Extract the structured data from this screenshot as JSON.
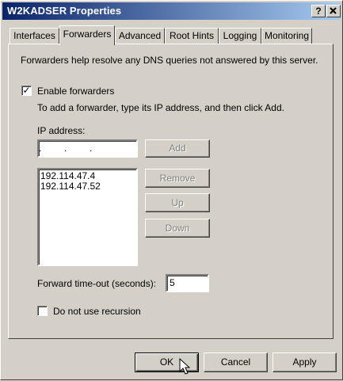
{
  "window": {
    "title": "W2KADSER Properties"
  },
  "titlebar_buttons": {
    "help": "?",
    "close": "X"
  },
  "tabs": [
    {
      "label": "Interfaces"
    },
    {
      "label": "Forwarders"
    },
    {
      "label": "Advanced"
    },
    {
      "label": "Root Hints"
    },
    {
      "label": "Logging"
    },
    {
      "label": "Monitoring"
    }
  ],
  "forwarders": {
    "description": "Forwarders help resolve any DNS queries not answered by this server.",
    "enable_label": "Enable forwarders",
    "enable_checked": "✓",
    "instruction": "To add a forwarder, type its IP address, and then click Add.",
    "ip_label": "IP address:",
    "ip_value": ".     .     .",
    "add_label": "Add",
    "list": [
      "192.114.47.4",
      "192.114.47.52"
    ],
    "remove_label": "Remove",
    "up_label": "Up",
    "down_label": "Down",
    "timeout_label": "Forward time-out (seconds):",
    "timeout_value": "5",
    "recursion_label": "Do not use recursion"
  },
  "buttons": {
    "ok": "OK",
    "cancel": "Cancel",
    "apply": "Apply"
  }
}
